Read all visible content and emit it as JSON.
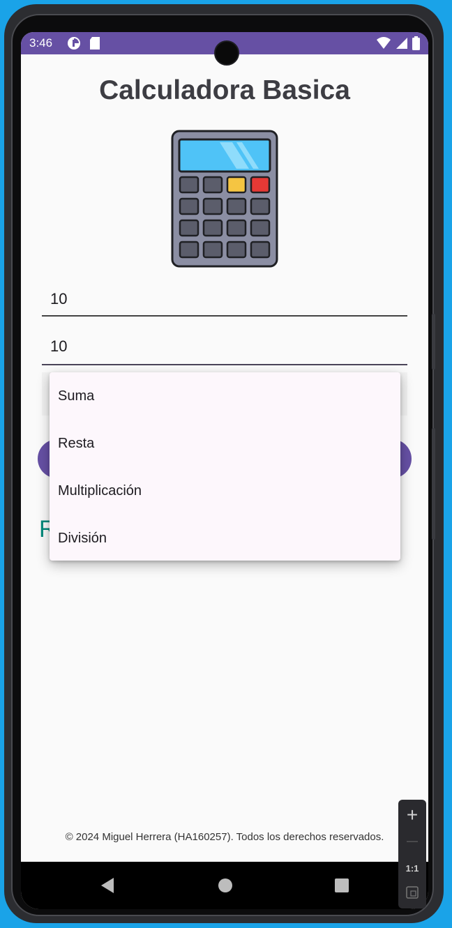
{
  "status_bar": {
    "time": "3:46",
    "icons_left": [
      "sync-icon",
      "sd-card-icon"
    ],
    "icons_right": [
      "wifi-icon",
      "signal-icon",
      "battery-icon"
    ],
    "color": "#6650a4"
  },
  "app": {
    "title": "Calculadora Basica",
    "image": "calculator-icon",
    "input1_value": "10",
    "input2_value": "10",
    "operations": [
      "Suma",
      "Resta",
      "Multiplicación",
      "División"
    ],
    "result_label_initial": "R",
    "footer": "© 2024 Miguel Herrera (HA160257). Todos los derechos reservados."
  },
  "emulator_controls": {
    "zoom_in": "+",
    "zoom_out": "—",
    "actual_size": "1:1"
  },
  "colors": {
    "primary": "#6650a4",
    "result_text": "#00897b",
    "frame": "#1aa3e8"
  }
}
